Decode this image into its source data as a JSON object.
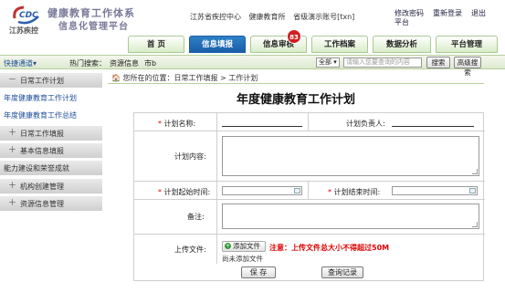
{
  "header": {
    "logo_text": "CDC",
    "logo_sub": "江苏疾控",
    "title_line1": "健康教育工作体系",
    "title_line2": "信息化管理平台",
    "user_org": "江苏省疾控中心",
    "user_dept": "健康教育所",
    "user_account": "省级演示账号[txn]",
    "change_password": "修改密码",
    "relogin": "重新登录",
    "logout": "退出",
    "platform": "平台"
  },
  "nav": {
    "tabs": [
      "首 页",
      "信息填报",
      "信息审核",
      "工作档案",
      "数据分析",
      "平台管理"
    ],
    "active": 1,
    "badge": "83"
  },
  "toolbar": {
    "quick_access": "快捷通道",
    "hot_search_label": "热门搜索：",
    "hot_search_1": "资源信息",
    "hot_search_2": "市b",
    "scope_select": "全部",
    "search_placeholder": "请输入您要查询的内容",
    "search_button": "搜索",
    "advanced_search": "高级搜索"
  },
  "sidebar": {
    "items": [
      {
        "label": "日常工作计划",
        "type": "head",
        "pm": "－"
      },
      {
        "label": "年度健康教育工作计划",
        "type": "sub"
      },
      {
        "label": "年度健康教育工作总结",
        "type": "sub"
      },
      {
        "label": "日常工作填报",
        "type": "head",
        "pm": "＋"
      },
      {
        "label": "基本信息填报",
        "type": "head",
        "pm": "＋"
      },
      {
        "label": "能力建设和荣誉成就",
        "type": "plain"
      },
      {
        "label": "机构创建管理",
        "type": "head",
        "pm": "＋"
      },
      {
        "label": "资源信息管理",
        "type": "head",
        "pm": "＋"
      }
    ]
  },
  "breadcrumb": {
    "text": "您所在的位置：日常工作填报 > 工作计划"
  },
  "form": {
    "title": "年度健康教育工作计划",
    "plan_name_label": "计划名称:",
    "owner_label": "计划负责人:",
    "content_label": "计划内容:",
    "start_label": "计划起始时间:",
    "end_label": "计划结束时间:",
    "remark_label": "备注:",
    "upload_label": "上传文件:",
    "upload_button": "添加文件",
    "upload_note": "注意：上传文件总大小不得超过50M",
    "no_file": "尚未添加文件",
    "required_mark": "*",
    "save_button": "保 存",
    "query_button": "查询记录"
  },
  "colors": {
    "nav_active": "#1a5ea8",
    "nav_tab": "#d9ecc9",
    "required": "#dd0000",
    "badge": "#d02020"
  }
}
